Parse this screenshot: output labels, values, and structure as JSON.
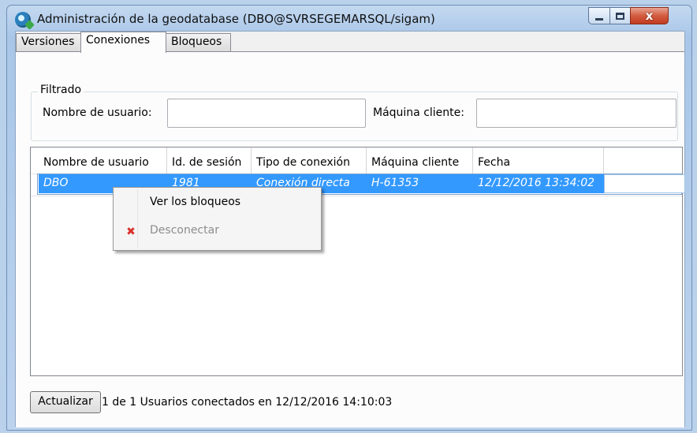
{
  "window": {
    "title": "Administración de la geodatabase (DBO@SVRSEGEMARSQL/sigam)",
    "controls": {
      "minimize": "minimize",
      "maximize": "maximize",
      "close": "x"
    }
  },
  "tabs": [
    {
      "label": "Versiones",
      "active": false
    },
    {
      "label": "Conexiones",
      "active": true
    },
    {
      "label": "Bloqueos",
      "active": false
    }
  ],
  "filter": {
    "group_label": "Filtrado",
    "user_label": "Nombre de usuario:",
    "user_value": "",
    "machine_label": "Máquina cliente:",
    "machine_value": ""
  },
  "grid": {
    "columns": [
      "Nombre de usuario",
      "Id. de sesión",
      "Tipo de conexión",
      "Máquina cliente",
      "Fecha"
    ],
    "rows": [
      [
        "DBO",
        "1981",
        "Conexión directa",
        "H-61353",
        "12/12/2016 13:34:02"
      ]
    ]
  },
  "context_menu": {
    "items": [
      {
        "label": "Ver los bloqueos",
        "enabled": true,
        "icon": ""
      },
      {
        "label": "Desconectar",
        "enabled": false,
        "icon": "red-x-icon"
      }
    ]
  },
  "footer": {
    "refresh_label": "Actualizar",
    "status": "1 de 1 Usuarios conectados en 12/12/2016 14:10:03"
  },
  "colors": {
    "selection": "#3399ff",
    "disconnect_icon": "#d9312d",
    "close_button": "#c13c20"
  }
}
